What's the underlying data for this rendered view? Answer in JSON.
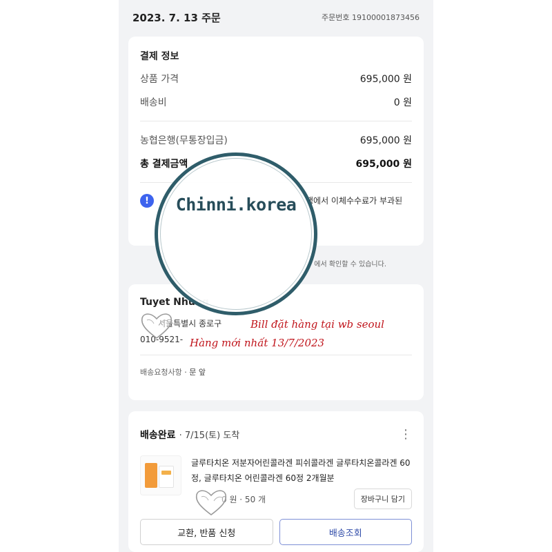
{
  "header": {
    "order_date": "2023. 7. 13 주문",
    "order_no": "주문번호 19100001873456"
  },
  "payment": {
    "title": "결제 정보",
    "rows": [
      {
        "label": "상품 가격",
        "value": "695,000 원"
      },
      {
        "label": "배송비",
        "value": "0 원"
      }
    ],
    "method_row": {
      "label": "농협은행(무통장입금)",
      "value": "695,000 원"
    },
    "total_row": {
      "label": "총 결제금액",
      "value": "695,000 원"
    },
    "notice_icon": "info-icon",
    "notice_text": "행에서 이체수수료가 부과된"
  },
  "sub_note": "에서 확인할 수 있습니다.",
  "address": {
    "name": "Tuyet Nhung",
    "addr": "서울특별시 종로구",
    "phone": "010-9521-",
    "request_label": "배송요청사항",
    "request_value": "· 문 앞"
  },
  "shipping": {
    "status": "배송완료",
    "date": "· 7/15(토) 도착",
    "more_icon": "more-vertical-icon",
    "product_name": "글루타치온 저분자어린콜라겐 피쉬콜라겐 글루타치온콜라겐 60정, 글루타치온 어린콜라겐 60정 2개월분",
    "price_qty": "0 원 · 50 개",
    "cart_button": "장바구니 담기",
    "exchange_button": "교환, 반품 신청",
    "track_button": "배송조회"
  },
  "overlay": {
    "seal_text": "Chinni.korea",
    "handwrite_1": "Bill  đặt hàng tại wb seoul",
    "handwrite_2": "Hàng mới nhất  13/7/2023",
    "heart_icon": "heart-outline-icon",
    "seal_color": "#2f5d6a",
    "handwrite_color": "#c0141b"
  }
}
